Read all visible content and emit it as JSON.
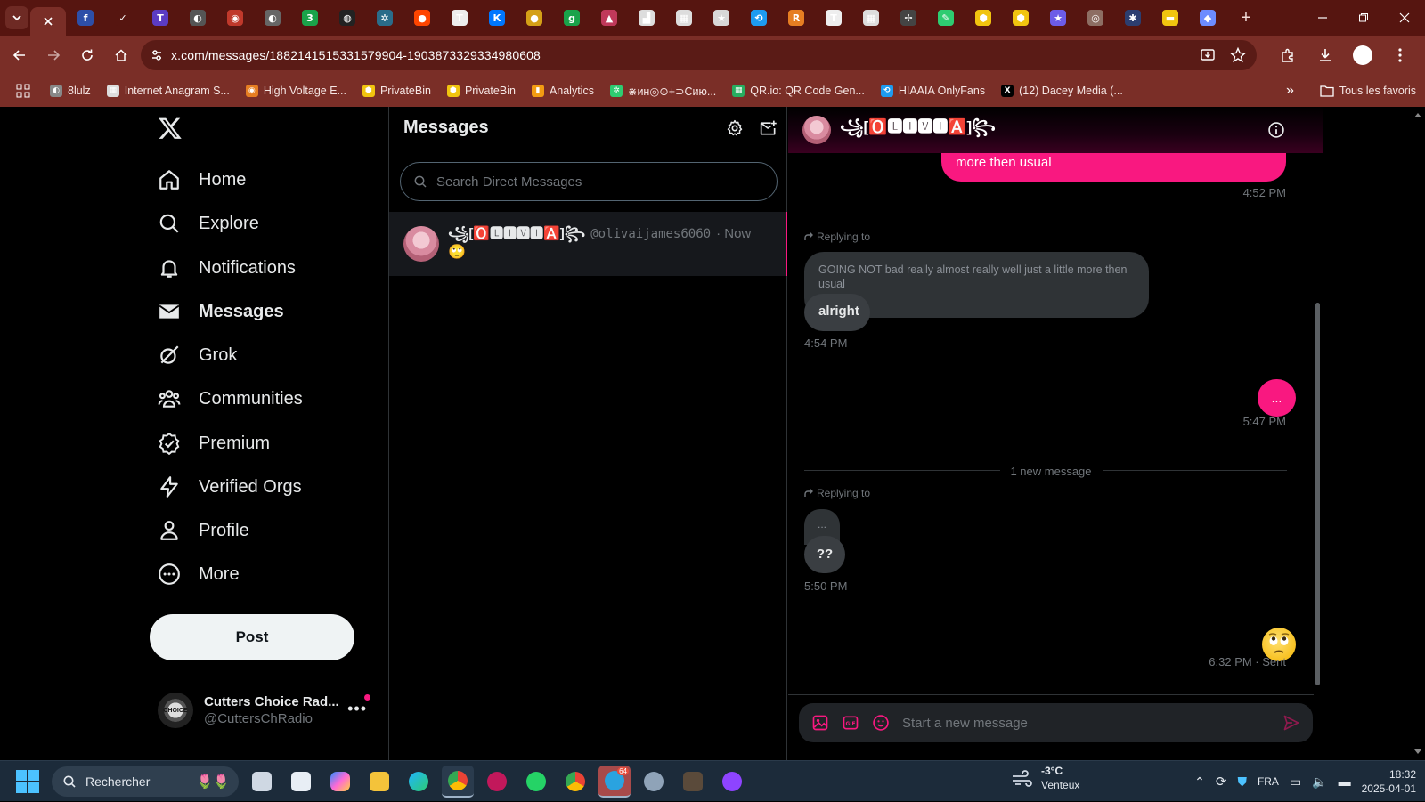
{
  "browser": {
    "tabs": [
      {
        "icon": "tab-favicon",
        "color": "#2d4fa8",
        "glyph": "f"
      },
      {
        "icon": "nike-icon",
        "color": "#561510",
        "glyph": "✓"
      },
      {
        "icon": "tab-favicon",
        "color": "#5b3cc4",
        "glyph": "T"
      },
      {
        "icon": "tab-favicon",
        "color": "#555555",
        "glyph": "◐"
      },
      {
        "icon": "tab-favicon",
        "color": "#c0392b",
        "glyph": "◉"
      },
      {
        "icon": "tab-favicon",
        "color": "#666666",
        "glyph": "◐"
      },
      {
        "icon": "tab-favicon",
        "color": "#1aa34a",
        "glyph": "3"
      },
      {
        "icon": "tab-favicon",
        "color": "#222222",
        "glyph": "◍"
      },
      {
        "icon": "tab-favicon",
        "color": "#2a6c8a",
        "glyph": "✲"
      },
      {
        "icon": "reddit-icon",
        "color": "#ff4500",
        "glyph": "●"
      },
      {
        "icon": "tab-favicon",
        "color": "#eeeeee",
        "glyph": "T"
      },
      {
        "icon": "vk-icon",
        "color": "#0077ff",
        "glyph": "К"
      },
      {
        "icon": "bulb-icon",
        "color": "#d4a017",
        "glyph": "●"
      },
      {
        "icon": "tab-favicon",
        "color": "#1aa34a",
        "glyph": "g"
      },
      {
        "icon": "tab-favicon",
        "color": "#c0395a",
        "glyph": "▲"
      },
      {
        "icon": "tab-favicon",
        "color": "#dddddd",
        "glyph": "▟"
      },
      {
        "icon": "tab-favicon",
        "color": "#dddddd",
        "glyph": "▦"
      },
      {
        "icon": "star-icon",
        "color": "#d8d8d8",
        "glyph": "★"
      },
      {
        "icon": "tab-favicon",
        "color": "#1d9bf0",
        "glyph": "⟲"
      },
      {
        "icon": "tab-favicon",
        "color": "#e67e22",
        "glyph": "R"
      },
      {
        "icon": "tab-favicon",
        "color": "#eeeeee",
        "glyph": "T"
      },
      {
        "icon": "tab-favicon",
        "color": "#dddddd",
        "glyph": "▦"
      },
      {
        "icon": "tab-favicon",
        "color": "#444444",
        "glyph": "✢"
      },
      {
        "icon": "tab-favicon",
        "color": "#2ecc71",
        "glyph": "✎"
      },
      {
        "icon": "privatebin-icon",
        "color": "#f1c40f",
        "glyph": "⬢"
      },
      {
        "icon": "privatebin-icon",
        "color": "#f1c40f",
        "glyph": "⬢"
      },
      {
        "icon": "star-icon",
        "color": "#6c5ce7",
        "glyph": "★"
      },
      {
        "icon": "tab-favicon",
        "color": "#8d6e63",
        "glyph": "◎"
      },
      {
        "icon": "tab-favicon",
        "color": "#2c3e70",
        "glyph": "✱"
      },
      {
        "icon": "tab-favicon",
        "color": "#f1c40f",
        "glyph": "▬"
      },
      {
        "icon": "tab-favicon",
        "color": "#6c8cff",
        "glyph": "◆"
      }
    ],
    "url": "x.com/messages/1882141515331579904-1903873329334980608",
    "bookmarks": [
      {
        "label": "8lulz",
        "color": "#888888",
        "glyph": "◐"
      },
      {
        "label": "Internet Anagram S...",
        "color": "#dddddd",
        "glyph": "▦"
      },
      {
        "label": "High Voltage E...",
        "color": "#e67e22",
        "glyph": "◉"
      },
      {
        "label": "PrivateBin",
        "color": "#f1c40f",
        "glyph": "⬢"
      },
      {
        "label": "PrivateBin",
        "color": "#f1c40f",
        "glyph": "⬢"
      },
      {
        "label": "Analytics",
        "color": "#f39c12",
        "glyph": "▮"
      },
      {
        "label": "⋇ин◎⊙+⊃Сию...",
        "color": "#2ecc71",
        "glyph": "✲"
      },
      {
        "label": "QR.io: QR Code Gen...",
        "color": "#27ae60",
        "glyph": "▦"
      },
      {
        "label": "HIAAIA OnlyFans",
        "color": "#1d9bf0",
        "glyph": "⟲"
      },
      {
        "label": "(12) Dacey Media (...",
        "color": "#000000",
        "glyph": "X"
      }
    ],
    "all_bookmarks_label": "Tous les favoris"
  },
  "nav": {
    "items": [
      {
        "label": "Home",
        "icon": "home-icon"
      },
      {
        "label": "Explore",
        "icon": "search-icon"
      },
      {
        "label": "Notifications",
        "icon": "bell-icon"
      },
      {
        "label": "Messages",
        "icon": "envelope-icon"
      },
      {
        "label": "Grok",
        "icon": "grok-icon"
      },
      {
        "label": "Communities",
        "icon": "communities-icon"
      },
      {
        "label": "Premium",
        "icon": "premium-icon"
      },
      {
        "label": "Verified Orgs",
        "icon": "lightning-icon"
      },
      {
        "label": "Profile",
        "icon": "person-icon"
      },
      {
        "label": "More",
        "icon": "more-circle-icon"
      }
    ],
    "post_label": "Post",
    "account": {
      "name": "Cutters Choice Rad...",
      "handle": "@CuttersChRadio",
      "avatar_text": "CHOICE"
    }
  },
  "messages": {
    "title": "Messages",
    "search_placeholder": "Search Direct Messages",
    "conversation": {
      "name": "꧁[🅾️🅻🅸🆅🅸🅰️]꧂",
      "handle": "@olivaijames6060",
      "time": "· Now",
      "preview": "🙄"
    }
  },
  "chat": {
    "name": "꧁[🅾️🅻🅸🆅🅸🅰️]꧂",
    "messages": {
      "m1_text": "more then usual",
      "m1_time": "4:52 PM",
      "m2_reply_label": "Replying to",
      "m2_quoted": "GOING NOT bad really almost really well just a little more then usual",
      "m2_text": "alright",
      "m2_time": "4:54 PM",
      "m3_text": "...",
      "m3_time": "5:47 PM",
      "new_message_divider": "1 new message",
      "m4_reply_label": "Replying to",
      "m4_quoted": "...",
      "m4_text": "??",
      "m4_time": "5:50 PM",
      "m5_text": "🙄",
      "m5_time": "6:32 PM · Sent"
    },
    "composer_placeholder": "Start a new message",
    "accent": "#f91880"
  },
  "taskbar": {
    "search_label": "Rechercher",
    "weather_temp": "-3°C",
    "weather_desc": "Venteux",
    "language": "FRA",
    "time": "18:32",
    "date": "2025-04-01",
    "telegram_badge": "64"
  }
}
